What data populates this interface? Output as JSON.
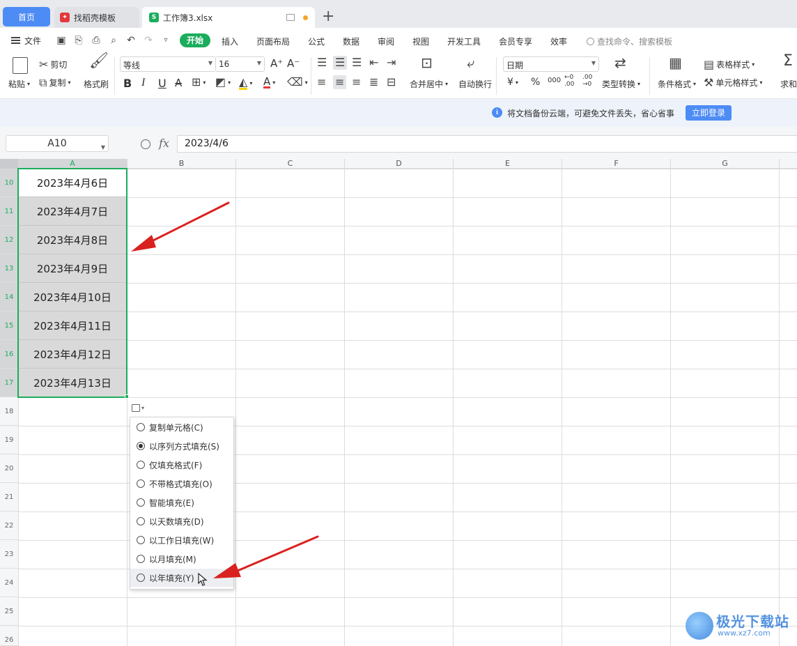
{
  "tabs": [
    {
      "label": "首页"
    },
    {
      "label": "找稻壳模板",
      "icon": "docer-icon"
    },
    {
      "label": "工作簿3.xlsx",
      "icon": "sheet-icon"
    }
  ],
  "menu": {
    "file": "文件",
    "items": [
      "开始",
      "插入",
      "页面布局",
      "公式",
      "数据",
      "审阅",
      "视图",
      "开发工具",
      "会员专享",
      "效率"
    ],
    "active": "开始",
    "search_placeholder": "查找命令、搜索模板"
  },
  "ribbon": {
    "paste": "粘贴",
    "cut": "剪切",
    "copy": "复制",
    "format_painter": "格式刷",
    "font_name": "等线",
    "font_size": "16",
    "bold": "B",
    "italic": "I",
    "underline": "U",
    "strike": "A",
    "font_color": "A",
    "increase_font": "A⁺",
    "decrease_font": "A⁻",
    "merge_center": "合并居中",
    "wrap_text": "自动换行",
    "number_format": "日期",
    "currency": "¥",
    "percent": "%",
    "thousands": "000",
    "dec_inc": "←0 .00",
    "dec_dec": ".00 →0",
    "type_convert": "类型转换",
    "cond_format": "条件格式",
    "table_style": "表格样式",
    "cell_style": "单元格样式",
    "sum": "求和"
  },
  "banner": {
    "text": "将文档备份云端，可避免文件丢失，省心省事",
    "login_button": "立即登录"
  },
  "formula_bar": {
    "name_box": "A10",
    "fx": "fx",
    "value": "2023/4/6"
  },
  "columns": [
    "A",
    "B",
    "C",
    "D",
    "E",
    "F",
    "G"
  ],
  "rows": [
    "10",
    "11",
    "12",
    "13",
    "14",
    "15",
    "16",
    "17",
    "18",
    "19",
    "20",
    "21",
    "22",
    "23",
    "24",
    "25",
    "26"
  ],
  "cells_A": [
    "2023年4月6日",
    "2023年4月7日",
    "2023年4月8日",
    "2023年4月9日",
    "2023年4月10日",
    "2023年4月11日",
    "2023年4月12日",
    "2023年4月13日"
  ],
  "autofill_menu": {
    "items": [
      {
        "label": "复制单元格(C)",
        "checked": false
      },
      {
        "label": "以序列方式填充(S)",
        "checked": true
      },
      {
        "label": "仅填充格式(F)",
        "checked": false
      },
      {
        "label": "不带格式填充(O)",
        "checked": false
      },
      {
        "label": "智能填充(E)",
        "checked": false
      },
      {
        "label": "以天数填充(D)",
        "checked": false
      },
      {
        "label": "以工作日填充(W)",
        "checked": false
      },
      {
        "label": "以月填充(M)",
        "checked": false
      },
      {
        "label": "以年填充(Y)",
        "checked": false
      }
    ]
  },
  "watermark": {
    "name": "极光下载站",
    "url": "www.xz7.com"
  },
  "colors": {
    "accent_green": "#1aad5c",
    "accent_blue": "#4d8bf5",
    "arrow_red": "#d9211f"
  }
}
